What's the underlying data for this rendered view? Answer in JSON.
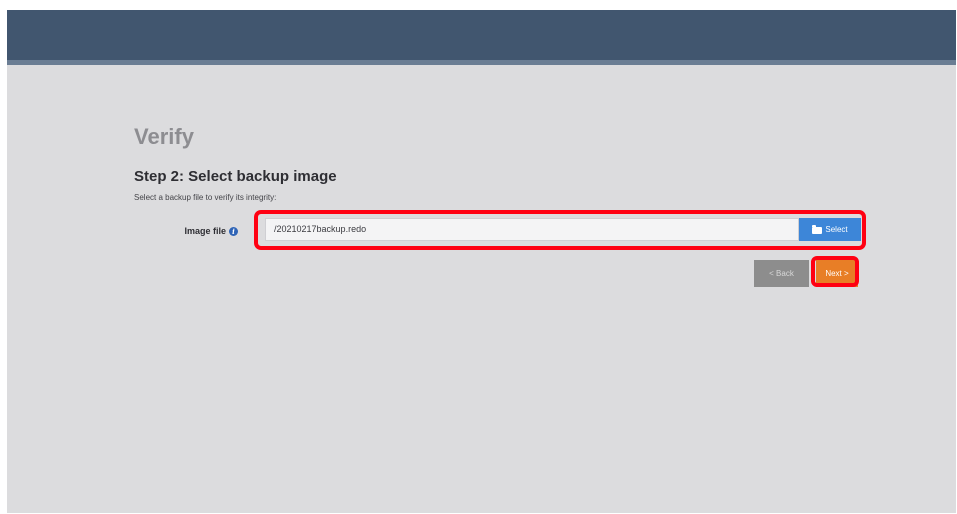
{
  "page": {
    "title": "Verify"
  },
  "step": {
    "title": "Step 2: Select backup image",
    "description": "Select a backup file to verify its integrity:"
  },
  "form": {
    "image_file_label": "Image file",
    "info_icon_glyph": "i",
    "image_file_value": "/20210217backup.redo",
    "select_label": "Select",
    "select_icon": "folder-open-icon"
  },
  "nav": {
    "back_label": "< Back",
    "next_label": "Next >"
  },
  "colors": {
    "header": "#41566f",
    "page_bg": "#dcdcde",
    "select_button": "#3d86d8",
    "back_button": "#8d8d8d",
    "next_button": "#e87e26",
    "highlight_outline": "#ff0012"
  }
}
